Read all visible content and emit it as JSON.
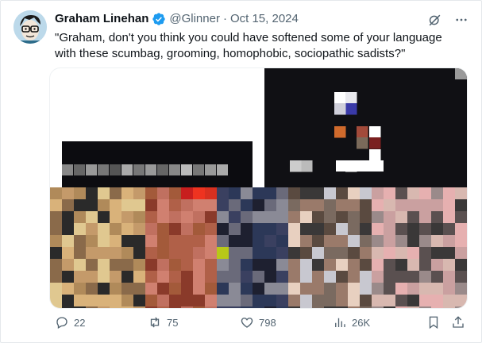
{
  "tweet": {
    "author_name": "Graham Linehan",
    "handle": "@Glinner",
    "separator": "·",
    "date": "Oct 15, 2024",
    "text": "\"Graham, don't you think you could have softened some of your language\nwith these scumbag, grooming, homophobic, sociopathic sadists?\"",
    "verified_color": "#1d9bf0"
  },
  "icons": {
    "avatar": "cartoon-avatar",
    "verified": "verified-badge-icon",
    "grok": "grok-icon",
    "more": "more-icon"
  },
  "media": {
    "description_hidden": true
  },
  "actions": {
    "replies": "22",
    "reposts": "75",
    "likes": "798",
    "views": "26K"
  },
  "colors": {
    "text": "#0f1419",
    "muted": "#536471",
    "border": "#e4e8eb"
  }
}
